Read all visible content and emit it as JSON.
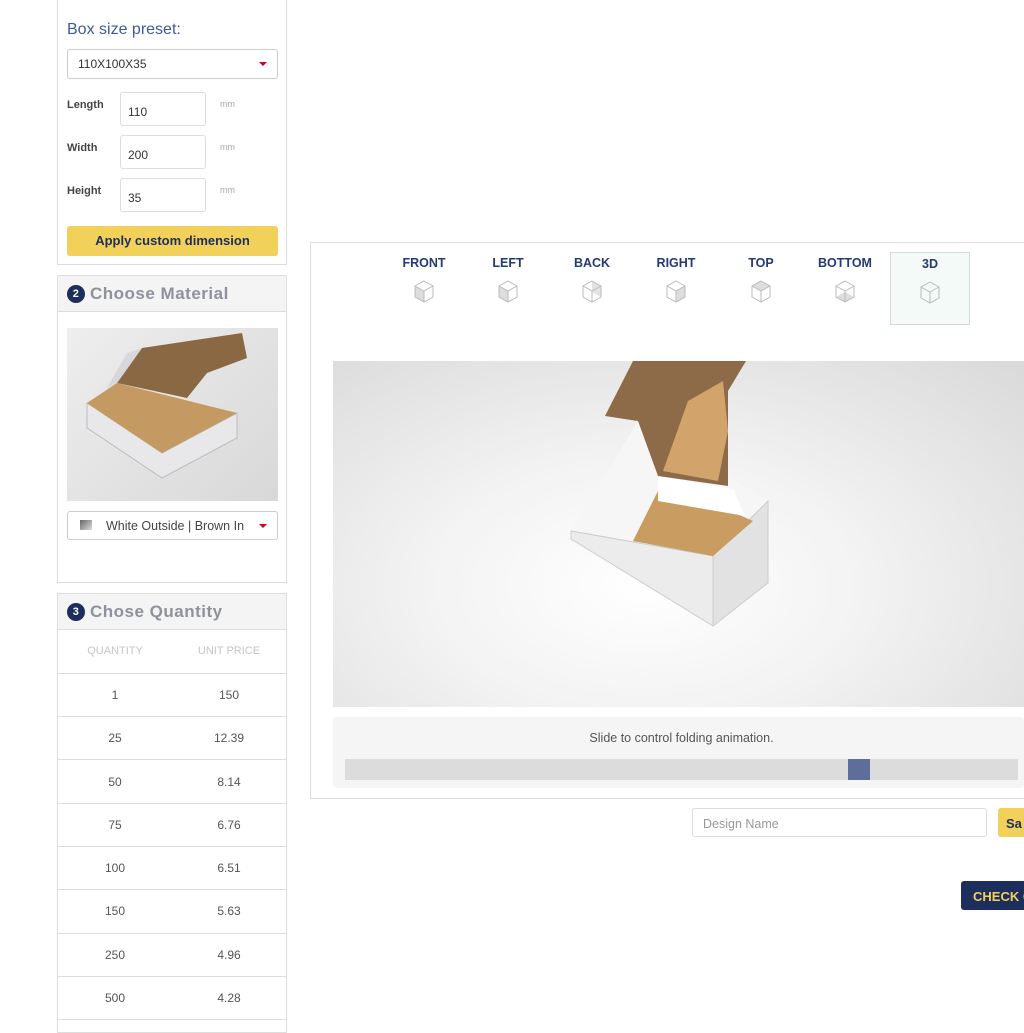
{
  "size_panel": {
    "title": "Box size preset:",
    "preset": "110X100X35",
    "fields": [
      {
        "label": "Length",
        "value": "110",
        "unit": "mm"
      },
      {
        "label": "Width",
        "value": "200",
        "unit": "mm"
      },
      {
        "label": "Height",
        "value": "35",
        "unit": "mm"
      }
    ],
    "apply_label": "Apply custom dimension"
  },
  "material_panel": {
    "step": "2",
    "title": "Choose Material",
    "material": "White Outside | Brown In"
  },
  "quantity_panel": {
    "step": "3",
    "title": "Chose Quantity",
    "headers": [
      "QUANTITY",
      "UNIT PRICE"
    ],
    "rows": [
      [
        "1",
        "150"
      ],
      [
        "25",
        "12.39"
      ],
      [
        "50",
        "8.14"
      ],
      [
        "75",
        "6.76"
      ],
      [
        "100",
        "6.51"
      ],
      [
        "150",
        "5.63"
      ],
      [
        "250",
        "4.96"
      ],
      [
        "500",
        "4.28"
      ]
    ]
  },
  "viewer": {
    "tabs": [
      "FRONT",
      "LEFT",
      "BACK",
      "RIGHT",
      "TOP",
      "BOTTOM",
      "3D"
    ],
    "active_tab": "3D",
    "slider_label": "Slide to control folding animation.",
    "slider_value": 0.78
  },
  "design_name_placeholder": "Design Name",
  "save_label": "Sa",
  "check_label": "CHECK O",
  "colors": {
    "accent_yellow": "#f2d15b",
    "navy": "#1d2d5c",
    "tab_text": "#233a74"
  }
}
